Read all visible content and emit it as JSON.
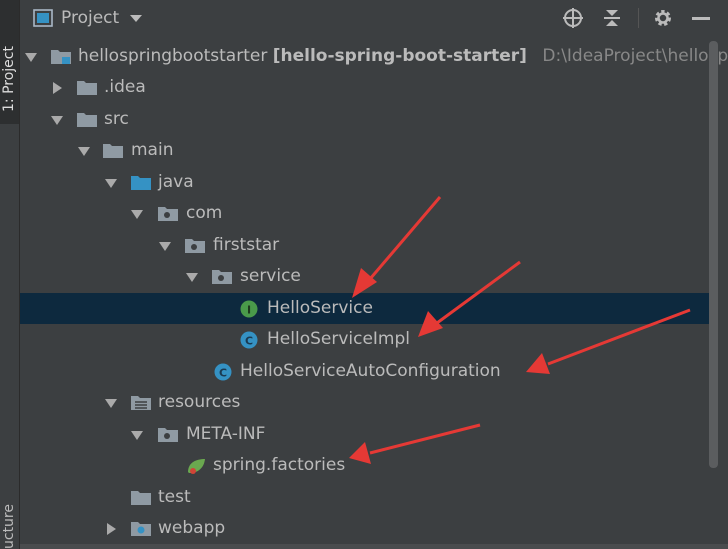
{
  "sidebar": {
    "project_tab": "1: Project",
    "structure_tab": "ucture"
  },
  "header": {
    "title": "Project",
    "icons": [
      "project-view-icon",
      "dropdown-icon",
      "locate-icon",
      "collapse-all-icon",
      "settings-icon",
      "hide-icon"
    ]
  },
  "tree": {
    "root_name": "hellospringbootstarter",
    "root_module": "[hello-spring-boot-starter]",
    "root_path": "D:\\IdeaProject\\hellosp",
    "idea": ".idea",
    "src": "src",
    "main": "main",
    "java": "java",
    "com": "com",
    "firststar": "firststar",
    "service": "service",
    "hello_service": "HelloService",
    "hello_service_impl": "HelloServiceImpl",
    "auto_config": "HelloServiceAutoConfiguration",
    "resources": "resources",
    "meta_inf": "META-INF",
    "spring_factories": "spring.factories",
    "test": "test",
    "webapp": "webapp"
  },
  "colors": {
    "background": "#3c3f41",
    "selection": "#0d293e",
    "annotation_arrow": "#e53935",
    "interface_icon": "#4a9a4a",
    "class_icon": "#3592c4"
  }
}
